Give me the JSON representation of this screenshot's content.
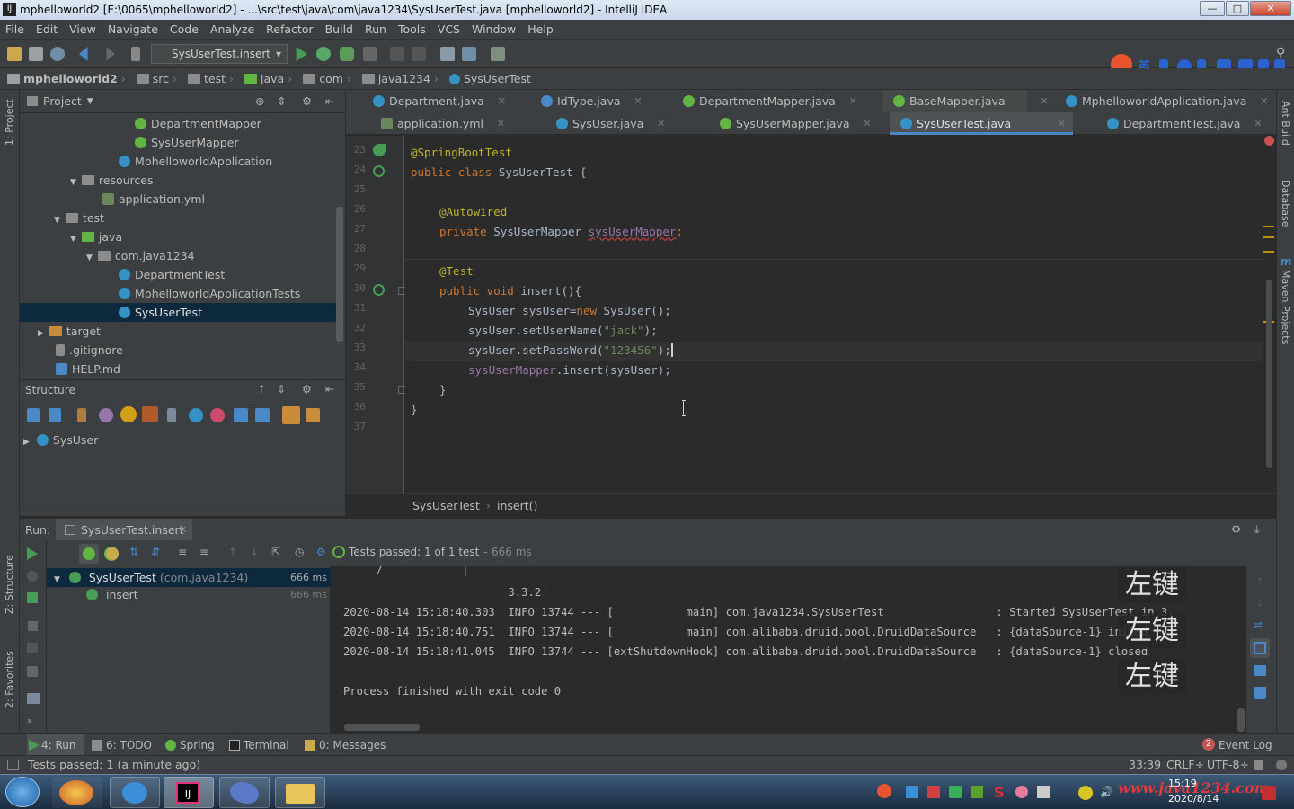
{
  "window": {
    "title": "mphelloworld2 [E:\\0065\\mphelloworld2] - ...\\src\\test\\java\\com\\java1234\\SysUserTest.java [mphelloworld2] - IntelliJ IDEA",
    "min": "—",
    "max": "□",
    "close": "✕"
  },
  "menu": [
    "File",
    "Edit",
    "View",
    "Navigate",
    "Code",
    "Analyze",
    "Refactor",
    "Build",
    "Run",
    "Tools",
    "VCS",
    "Window",
    "Help"
  ],
  "toolbar": {
    "run_config": "SysUserTest.insert"
  },
  "ime": {
    "lang": "英"
  },
  "breadcrumbs": [
    "mphelloworld2",
    "src",
    "test",
    "java",
    "com",
    "java1234",
    "SysUserTest"
  ],
  "left_strip": {
    "project": "1: Project",
    "structure": "Z: Structure",
    "favorites": "2: Favorites"
  },
  "right_strip": {
    "ant": "Ant Build",
    "database": "Database",
    "maven": "Maven Projects"
  },
  "project_panel": {
    "title": "Project",
    "items": [
      {
        "label": "DepartmentMapper"
      },
      {
        "label": "SysUserMapper"
      },
      {
        "label": "MphelloworldApplication"
      },
      {
        "label": "resources"
      },
      {
        "label": "application.yml"
      },
      {
        "label": "test"
      },
      {
        "label": "java"
      },
      {
        "label": "com.java1234"
      },
      {
        "label": "DepartmentTest"
      },
      {
        "label": "MphelloworldApplicationTests"
      },
      {
        "label": "SysUserTest"
      },
      {
        "label": "target"
      },
      {
        "label": ".gitignore"
      },
      {
        "label": "HELP.md"
      }
    ]
  },
  "structure_panel": {
    "title": "Structure",
    "root": "SysUser"
  },
  "editor_tabs": {
    "row1": [
      "Department.java",
      "IdType.java",
      "DepartmentMapper.java",
      "BaseMapper.java",
      "MphelloworldApplication.java"
    ],
    "row2": [
      "application.yml",
      "SysUser.java",
      "SysUserMapper.java",
      "SysUserTest.java",
      "DepartmentTest.java"
    ],
    "active": "SysUserTest.java"
  },
  "code": {
    "line_numbers": [
      "23",
      "24",
      "25",
      "26",
      "27",
      "28",
      "29",
      "30",
      "31",
      "32",
      "33",
      "34",
      "35",
      "36",
      "37"
    ],
    "l23_ann": "@SpringBootTest",
    "l24_kw": "public class ",
    "l24_rest": "SysUserTest {",
    "l26_ann": "@Autowired",
    "l27_kw": "private ",
    "l27_type": "SysUserMapper ",
    "l27_field": "sysUserMapper",
    "l27_end": ";",
    "l29_ann": "@Test",
    "l30_kw": "public void ",
    "l30_rest": "insert(){",
    "l31_a": "SysUser sysUser=",
    "l31_kw": "new ",
    "l31_b": "SysUser();",
    "l32_a": "sysUser.setUserName(",
    "l32_str": "\"jack\"",
    "l32_b": ");",
    "l33_a": "sysUser.setPassWord(",
    "l33_str": "\"123456\"",
    "l33_b": ");",
    "l34_field": "sysUserMapper",
    "l34_b": ".insert(sysUser);",
    "l35": "}",
    "l36": "}"
  },
  "editor_breadcrumb": {
    "class": "SysUserTest",
    "method": "insert()"
  },
  "run_panel": {
    "label": "Run:",
    "tab": "SysUserTest.insert",
    "status": "Tests passed:",
    "status_count": "1 of 1 test",
    "status_time": "– 666 ms",
    "tree": [
      {
        "name": "SysUserTest",
        "pkg": "(com.java1234)",
        "time": "666 ms"
      },
      {
        "name": "insert",
        "pkg": "",
        "time": "666 ms"
      }
    ]
  },
  "console": {
    "lines": [
      "     /            |",
      "                         3.3.2",
      "2020-08-14 15:18:40.303  INFO 13744 --- [           main] com.java1234.SysUserTest                 : Started SysUserTest in 3.",
      "2020-08-14 15:18:40.751  INFO 13744 --- [           main] com.alibaba.druid.pool.DruidDataSource   : {dataSource-1} inited",
      "2020-08-14 15:18:41.045  INFO 13744 --- [extShutdownHook] com.alibaba.druid.pool.DruidDataSource   : {dataSource-1} closed",
      "",
      "Process finished with exit code 0"
    ],
    "overlay_key": "左键"
  },
  "bottom_tabs": [
    {
      "label": "4: Run"
    },
    {
      "label": "6: TODO"
    },
    {
      "label": "Spring"
    },
    {
      "label": "Terminal"
    },
    {
      "label": "0: Messages"
    }
  ],
  "event_log": {
    "count": "2",
    "label": "Event Log"
  },
  "status": {
    "message": "Tests passed: 1 (a minute ago)",
    "position": "33:39",
    "line_sep": "CRLF÷",
    "encoding": "UTF-8÷"
  },
  "taskbar": {
    "time": "15:19",
    "date": "2020/8/14",
    "watermark": "www.java1234.com"
  },
  "colors": {
    "accent": "#4a88c7",
    "pass": "#499c54",
    "keyword": "#cc7832",
    "annotation": "#bbb529",
    "string": "#6a8759",
    "field": "#9876aa"
  }
}
